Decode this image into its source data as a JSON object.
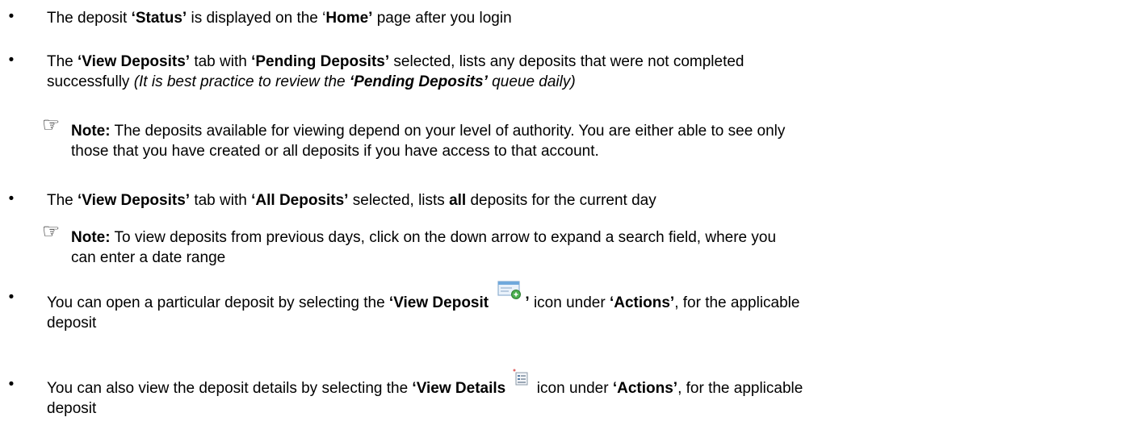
{
  "bullets": [
    {
      "t1": "The deposit ",
      "b1": "‘Status’",
      "t2": " is displayed on the ‘",
      "b2": "Home’",
      "t3": " page after you login"
    },
    {
      "t1": "The ",
      "b1": "‘View Deposits’",
      "t2": " tab with ",
      "b2": "‘Pending Deposits’",
      "t3": " selected, lists any deposits that were not completed",
      "t4": "successfully ",
      "i1": "(It is best practice to review the ",
      "ib1": "‘Pending Deposits’",
      "i2": " queue daily)"
    },
    {
      "t1": "The ",
      "b1": "‘View Deposits’",
      "t2": " tab with ",
      "b2": "‘All Deposits’",
      "t3": " selected, lists ",
      "b3": "all",
      "t4": " deposits for the current day"
    },
    {
      "t1": "You can open a particular deposit by selecting the ",
      "b1": "‘View Deposit ",
      "b2": "’",
      "t2": " icon under ",
      "b3": "‘Actions’",
      "t3": ", for the applicable",
      "t4": "deposit"
    },
    {
      "t1": "You can also view the deposit details by selecting the ",
      "b1": "‘View Details ",
      "t2": " icon under ",
      "b2": "‘Actions’",
      "t3": ", for the applicable",
      "t4": "deposit"
    }
  ],
  "notes": [
    {
      "label": "Note:",
      "line1": " The deposits available for viewing depend on your level of authority. You are either able to see only",
      "line2": "those that you have created or all deposits if you have access to that account."
    },
    {
      "label": "Note:",
      "line1": " To view deposits from previous days, click on the down arrow to expand a search field, where you",
      "line2": "can enter a date range"
    }
  ],
  "icons": {
    "bullet": "•",
    "pointing_hand": "☞",
    "view_deposit": "view-deposit-icon",
    "view_details": "view-details-icon"
  },
  "colors": {
    "text": "#000000",
    "view_deposit_icon_green": "#4caf50",
    "view_deposit_icon_blue": "#6fa8dc"
  }
}
